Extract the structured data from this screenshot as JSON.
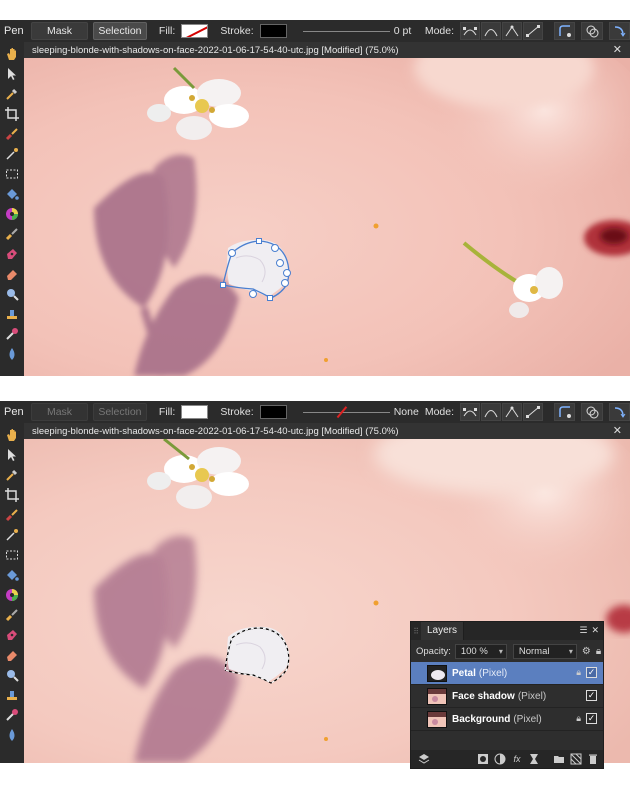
{
  "top": {
    "toolbar": {
      "tool_name": "Pen",
      "mask_label": "Mask",
      "selection_label": "Selection",
      "fill_label": "Fill:",
      "stroke_label": "Stroke:",
      "stroke_width": "0 pt",
      "mode_label": "Mode:"
    },
    "doc_title": "sleeping-blonde-with-shadows-on-face-2022-01-06-17-54-40-utc.jpg [Modified] (75.0%)",
    "close_glyph": "✕"
  },
  "bottom": {
    "toolbar": {
      "tool_name": "Pen",
      "mask_label": "Mask",
      "selection_label": "Selection",
      "fill_label": "Fill:",
      "stroke_label": "Stroke:",
      "stroke_width": "None",
      "mode_label": "Mode:"
    },
    "doc_title": "sleeping-blonde-with-shadows-on-face-2022-01-06-17-54-40-utc.jpg [Modified] (75.0%)",
    "close_glyph": "✕"
  },
  "layers_panel": {
    "tab_label": "Layers",
    "opacity_label": "Opacity:",
    "opacity_value": "100 %",
    "blend_mode": "Normal",
    "layers": [
      {
        "name": "Petal",
        "type": "(Pixel)",
        "selected": true,
        "locked": true,
        "visible": true
      },
      {
        "name": "Face shadow",
        "type": "(Pixel)",
        "selected": false,
        "locked": false,
        "visible": true
      },
      {
        "name": "Background",
        "type": "(Pixel)",
        "selected": false,
        "locked": true,
        "visible": true
      }
    ]
  },
  "colors": {
    "ui_dark": "#2b2b2b",
    "selected_layer": "#5b7fbf",
    "skin": "#f2c9c0",
    "shadow": "#9a6a80"
  },
  "icons": [
    "hand-icon",
    "move-icon",
    "eyedropper-icon",
    "crop-icon",
    "brush-icon",
    "selection-brush-icon",
    "marquee-icon",
    "fill-icon",
    "color-wheel-icon",
    "paint-brush-icon",
    "pen-icon",
    "eraser-icon",
    "zoom-icon",
    "stamp-icon",
    "dodge-icon",
    "blur-icon"
  ]
}
